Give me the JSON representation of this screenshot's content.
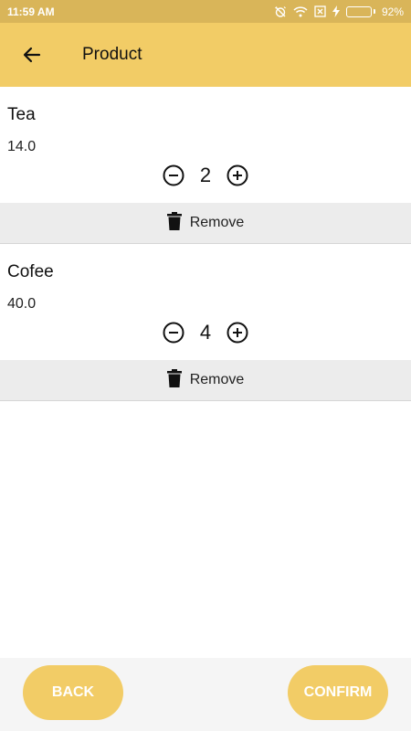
{
  "status_bar": {
    "time": "11:59 AM",
    "battery_percent": "92%",
    "battery_level": 0.92,
    "icons": [
      "alarm-off-icon",
      "wifi-icon",
      "sim-x-icon",
      "charging-bolt-icon",
      "battery-icon"
    ]
  },
  "app_bar": {
    "title": "Product",
    "back_icon": "arrow-back-icon",
    "background": "#f2cc66"
  },
  "items": [
    {
      "name": "Tea",
      "price": "14.0",
      "quantity": "2",
      "remove_label": "Remove"
    },
    {
      "name": "Cofee",
      "price": "40.0",
      "quantity": "4",
      "remove_label": "Remove"
    }
  ],
  "footer": {
    "back_label": "BACK",
    "confirm_label": "CONFIRM",
    "button_color": "#f2cc66"
  }
}
